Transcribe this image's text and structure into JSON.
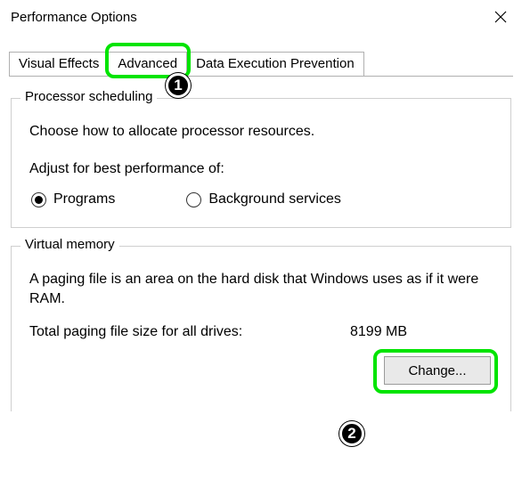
{
  "window": {
    "title": "Performance Options"
  },
  "tabs": {
    "visual_effects": "Visual Effects",
    "advanced": "Advanced",
    "dep": "Data Execution Prevention"
  },
  "annotations": {
    "badge1": "1",
    "badge2": "2"
  },
  "processor": {
    "legend": "Processor scheduling",
    "desc": "Choose how to allocate processor resources.",
    "adjust_label": "Adjust for best performance of:",
    "option_programs": "Programs",
    "option_background": "Background services",
    "selected": "programs"
  },
  "vm": {
    "legend": "Virtual memory",
    "desc": "A paging file is an area on the hard disk that Windows uses as if it were RAM.",
    "total_label": "Total paging file size for all drives:",
    "total_value": "8199 MB",
    "change_button": "Change..."
  }
}
